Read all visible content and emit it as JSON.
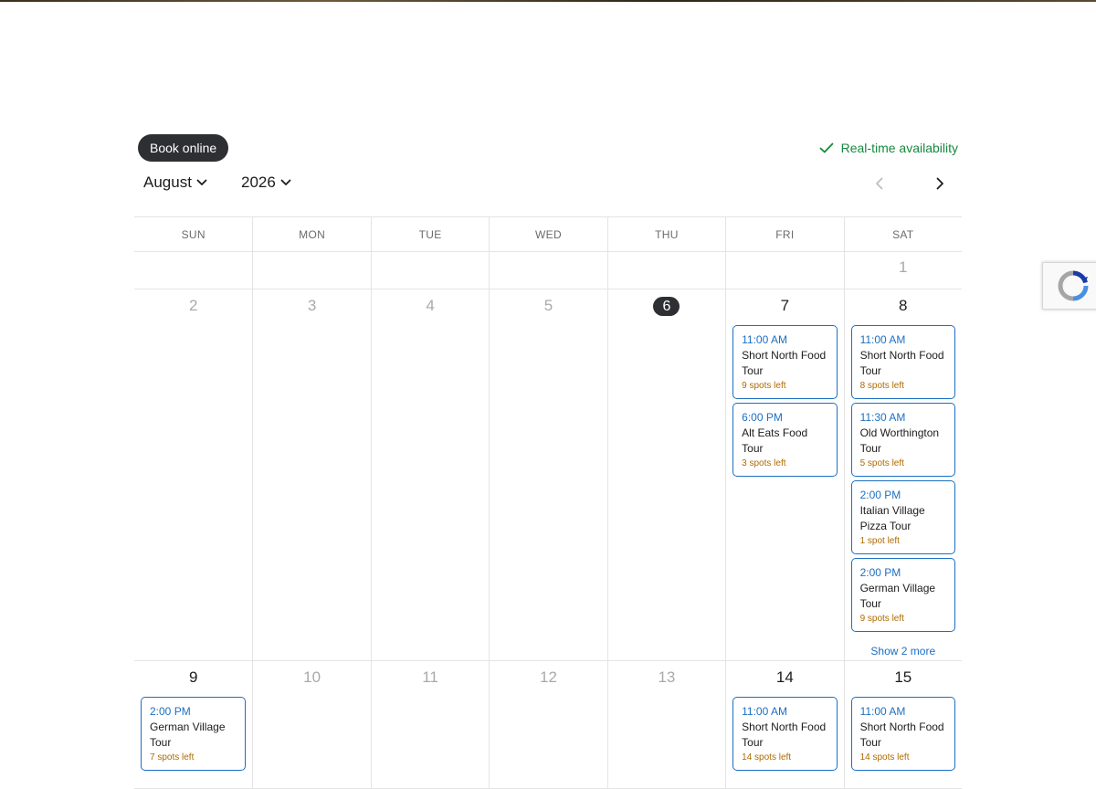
{
  "header": {
    "book_label": "Book online",
    "realtime_label": "Real-time availability"
  },
  "nav": {
    "month": "August",
    "year": "2026"
  },
  "weekdays": [
    "SUN",
    "MON",
    "TUE",
    "WED",
    "THU",
    "FRI",
    "SAT"
  ],
  "colors": {
    "accent": "#1d6fc2",
    "spots": "#b06a00",
    "realtime": "#16883f",
    "dark": "#2d2f33"
  },
  "calendar": {
    "week1": {
      "sat": {
        "day": "1"
      }
    },
    "week2": {
      "sun": {
        "day": "2"
      },
      "mon": {
        "day": "3"
      },
      "tue": {
        "day": "4"
      },
      "wed": {
        "day": "5"
      },
      "thu": {
        "day": "6"
      },
      "fri": {
        "day": "7",
        "events": [
          {
            "time": "11:00 AM",
            "name": "Short North Food Tour",
            "spots": "9 spots left"
          },
          {
            "time": "6:00 PM",
            "name": "Alt Eats Food Tour",
            "spots": "3 spots left"
          }
        ]
      },
      "sat": {
        "day": "8",
        "events": [
          {
            "time": "11:00 AM",
            "name": "Short North Food Tour",
            "spots": "8 spots left"
          },
          {
            "time": "11:30 AM",
            "name": "Old Worthington Tour",
            "spots": "5 spots left"
          },
          {
            "time": "2:00 PM",
            "name": "Italian Village Pizza Tour",
            "spots": "1 spot left"
          },
          {
            "time": "2:00 PM",
            "name": "German Village Tour",
            "spots": "9 spots left"
          }
        ],
        "more": "Show 2 more"
      }
    },
    "week3": {
      "sun": {
        "day": "9",
        "events": [
          {
            "time": "2:00 PM",
            "name": "German Village Tour",
            "spots": "7 spots left"
          }
        ]
      },
      "mon": {
        "day": "10"
      },
      "tue": {
        "day": "11"
      },
      "wed": {
        "day": "12"
      },
      "thu": {
        "day": "13"
      },
      "fri": {
        "day": "14",
        "events": [
          {
            "time": "11:00 AM",
            "name": "Short North Food Tour",
            "spots": "14 spots left"
          }
        ]
      },
      "sat": {
        "day": "15",
        "events": [
          {
            "time": "11:00 AM",
            "name": "Short North Food Tour",
            "spots": "14 spots left"
          }
        ]
      }
    }
  }
}
